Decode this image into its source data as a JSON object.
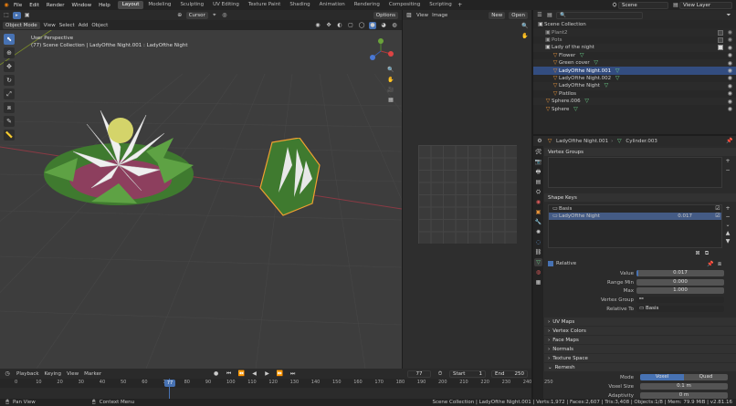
{
  "topbar": {
    "menus": [
      "File",
      "Edit",
      "Render",
      "Window",
      "Help"
    ],
    "workspaces": [
      "Layout",
      "Modeling",
      "Sculpting",
      "UV Editing",
      "Texture Paint",
      "Shading",
      "Animation",
      "Rendering",
      "Compositing",
      "Scripting"
    ],
    "active_workspace": "Layout",
    "scene": "Scene",
    "view_layer": "View Layer"
  },
  "viewport": {
    "mode": "Object Mode",
    "menus": [
      "View",
      "Select",
      "Add",
      "Object"
    ],
    "transform_orientation": "Cursor",
    "options_label": "Options",
    "perspective": "User Perspective",
    "collection_path": "(77) Scene Collection | LadyOfthe Night.001 : LadyOfthe Night"
  },
  "image_editor": {
    "menus": [
      "View",
      "Image"
    ],
    "new_label": "New",
    "open_label": "Open"
  },
  "outliner": {
    "rows": [
      {
        "label": "Scene Collection",
        "indent": 0
      },
      {
        "label": "Plant2",
        "indent": 1
      },
      {
        "label": "Pots",
        "indent": 1
      },
      {
        "label": "Lady of the night",
        "indent": 1
      },
      {
        "label": "Flower",
        "indent": 2
      },
      {
        "label": "Green cover",
        "indent": 2
      },
      {
        "label": "LadyOfthe Night.001",
        "indent": 2,
        "selected": true
      },
      {
        "label": "LadyOfthe Night.002",
        "indent": 2
      },
      {
        "label": "LadyOfthe Night",
        "indent": 2
      },
      {
        "label": "Pistilos",
        "indent": 2
      },
      {
        "label": "Sphere.006",
        "indent": 1
      },
      {
        "label": "Sphere",
        "indent": 1
      }
    ]
  },
  "properties": {
    "object_name": "LadyOfthe Night.001",
    "mesh_name": "Cylinder.003",
    "vertex_groups_label": "Vertex Groups",
    "shape_keys_label": "Shape Keys",
    "shape_keys": [
      {
        "name": "Basis",
        "value": ""
      },
      {
        "name": "LadyOfthe Night",
        "value": "0.017"
      }
    ],
    "relative_label": "Relative",
    "value_label": "Value",
    "value": "0.017",
    "range_min_label": "Range Min",
    "range_min": "0.000",
    "max_label": "Max",
    "max": "1.000",
    "vertex_group_label": "Vertex Group",
    "relative_to_label": "Relative To",
    "relative_to": "Basis",
    "sections": [
      "UV Maps",
      "Vertex Colors",
      "Face Maps",
      "Normals",
      "Texture Space",
      "Remesh"
    ],
    "mode_label": "Mode",
    "mode_voxel": "Voxel",
    "mode_quad": "Quad",
    "voxel_size_label": "Voxel Size",
    "voxel_size": "0.1 m",
    "adaptivity_label": "Adaptivity",
    "adaptivity": "0 m"
  },
  "timeline": {
    "menus": [
      "Playback",
      "Keying",
      "View",
      "Marker"
    ],
    "current_frame": "77",
    "start_label": "Start",
    "start": "1",
    "end_label": "End",
    "end": "250",
    "ticks": [
      "0",
      "10",
      "20",
      "30",
      "40",
      "50",
      "60",
      "70",
      "80",
      "90",
      "100",
      "110",
      "120",
      "130",
      "140",
      "150",
      "160",
      "170",
      "180",
      "190",
      "200",
      "210",
      "220",
      "230",
      "240",
      "250"
    ]
  },
  "status": {
    "left": "Pan View",
    "middle": "Context Menu",
    "right": "Scene Collection | LadyOfthe Night.001 | Verts:1,972 | Faces:2,607 | Tris:3,408 | Objects:1/8 | Mem: 79.9 MiB | v2.81.16"
  }
}
